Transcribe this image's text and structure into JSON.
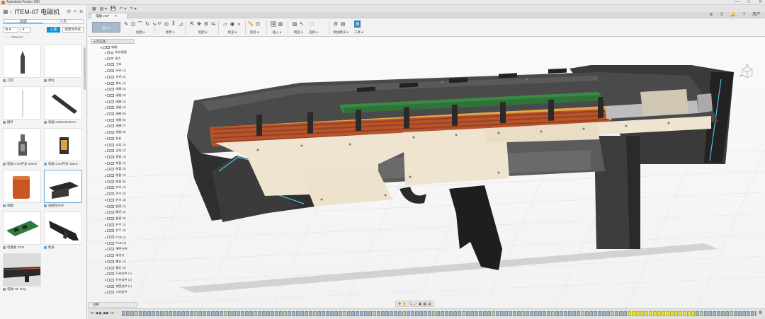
{
  "app": {
    "title": "Autodesk Fusion 360",
    "window_controls": [
      "—",
      "□",
      "✕"
    ]
  },
  "data_panel": {
    "project_title": "ITEM-07 电磁机",
    "tabs": [
      "数据",
      "人员"
    ],
    "upload_label": "上载",
    "new_folder_label": "新建文件夹",
    "breadcrumb": "ITEM-07",
    "items": [
      {
        "caption": "刀刺",
        "kind": "spike"
      },
      {
        "caption": "弹丸",
        "kind": "blank"
      },
      {
        "caption": "撞针",
        "kind": "needle"
      },
      {
        "caption": "电磁 2400x40x4mm",
        "kind": "bar"
      },
      {
        "caption": "电磁 2.5V开关 19mm",
        "kind": "switch"
      },
      {
        "caption": "电磁 2.5V开关 18pcs",
        "kind": "block"
      },
      {
        "caption": "线圈",
        "kind": "coil"
      },
      {
        "caption": "线圈架外护",
        "kind": "housing"
      },
      {
        "caption": "电路板 PCB",
        "kind": "pcb"
      },
      {
        "caption": "枪身",
        "kind": "gun"
      },
      {
        "caption": "电磁 7th 3hrg",
        "kind": "render"
      }
    ]
  },
  "toolbar": {
    "doc_tab": "电磁 v30*",
    "workspace": "设计 ▾",
    "groups": [
      "创建 ▾",
      "修改 ▾",
      "装配 ▾",
      "构造 ▾",
      "检验 ▾",
      "插入 ▾",
      "制造 ▾",
      "选择 ▾",
      "添加模块 ▾",
      "工具 ▾"
    ],
    "right_icons": [
      "⊕",
      "⏱",
      "🔔",
      "?",
      "用户"
    ]
  },
  "browser": {
    "header": "浏览器",
    "root": "电磁",
    "nodes": [
      "命名视图",
      "原点",
      "主体",
      "外壳 (1)",
      "外壳 (2)",
      "弹丸 (1)",
      "线圈 (1)",
      "线圈 (2)",
      "线圈 (3)",
      "线圈 (4)",
      "线圈 (5)",
      "线圈 (6)",
      "线圈 (7)",
      "线圈 (8)",
      "扳机",
      "支架 (1)",
      "支架 (2)",
      "枪管 (1)",
      "枪管 (2)",
      "枪管 (3)",
      "枪管 (4)",
      "枪管 (5)",
      "护木 (1)",
      "护木 (2)",
      "护木 (3)",
      "握把 (1)",
      "握把 (2)",
      "握把 (3)",
      "护手 (1)",
      "护手 (2)",
      "PCB (1)",
      "PCB (2)",
      "弹匣外壳",
      "电池仓",
      "螺丝 (1)",
      "螺丝 (2)",
      "开关组件 (1)",
      "开关组件 (2)",
      "弹匣组件 (1)",
      "刀刺组件"
    ]
  },
  "bottom": {
    "comments_label": "注释",
    "nav_icons": [
      "✥",
      "✋",
      "🔍",
      "⤢",
      "▣",
      "▦",
      "▤"
    ],
    "timeline_controls": [
      "⏮",
      "◀",
      "▶",
      "▶▶",
      "⏭"
    ]
  }
}
